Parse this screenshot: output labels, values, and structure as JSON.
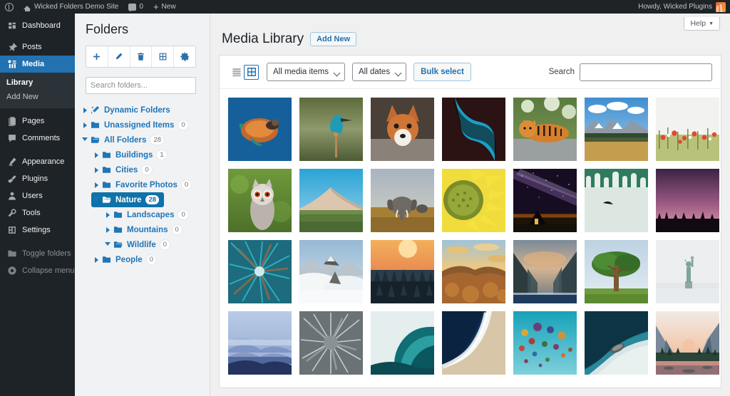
{
  "adminbar": {
    "wp_logo": "wordpress-logo",
    "site_name": "Wicked Folders Demo Site",
    "comments_count": "0",
    "new_label": "New",
    "howdy": "Howdy, Wicked Plugins"
  },
  "adminmenu": {
    "items": [
      {
        "label": "Dashboard",
        "icon": "dashboard-icon",
        "current": false
      },
      {
        "label": "Posts",
        "icon": "pin-icon",
        "current": false
      },
      {
        "label": "Media",
        "icon": "media-icon",
        "current": true
      },
      {
        "label": "Pages",
        "icon": "pages-icon",
        "current": false
      },
      {
        "label": "Comments",
        "icon": "comments-icon",
        "current": false
      },
      {
        "label": "Appearance",
        "icon": "appearance-icon",
        "current": false
      },
      {
        "label": "Plugins",
        "icon": "plugins-icon",
        "current": false
      },
      {
        "label": "Users",
        "icon": "users-icon",
        "current": false
      },
      {
        "label": "Tools",
        "icon": "tools-icon",
        "current": false
      },
      {
        "label": "Settings",
        "icon": "settings-icon",
        "current": false
      },
      {
        "label": "Toggle folders",
        "icon": "folder-icon",
        "current": false
      },
      {
        "label": "Collapse menu",
        "icon": "collapse-icon",
        "current": false
      }
    ],
    "media_submenu": [
      {
        "label": "Library",
        "current": true
      },
      {
        "label": "Add New",
        "current": false
      }
    ]
  },
  "folders": {
    "title": "Folders",
    "toolbar": [
      {
        "name": "add-folder-button",
        "icon": "plus-icon"
      },
      {
        "name": "edit-folder-button",
        "icon": "pencil-icon"
      },
      {
        "name": "delete-folder-button",
        "icon": "trash-icon"
      },
      {
        "name": "organize-button",
        "icon": "grid-plus-icon"
      },
      {
        "name": "folder-settings-button",
        "icon": "gear-icon"
      }
    ],
    "search_placeholder": "Search folders...",
    "tree": [
      {
        "label": "Dynamic Folders",
        "count": "",
        "depth": 0,
        "expanded": false,
        "selected": false,
        "icon": "magic-wand-icon"
      },
      {
        "label": "Unassigned Items",
        "count": "0",
        "depth": 0,
        "expanded": false,
        "selected": false,
        "icon": "folder-icon"
      },
      {
        "label": "All Folders",
        "count": "28",
        "depth": 0,
        "expanded": true,
        "selected": false,
        "icon": "folder-open-icon"
      },
      {
        "label": "Buildings",
        "count": "1",
        "depth": 1,
        "expanded": false,
        "selected": false,
        "icon": "folder-icon"
      },
      {
        "label": "Cities",
        "count": "0",
        "depth": 1,
        "expanded": false,
        "selected": false,
        "icon": "folder-icon"
      },
      {
        "label": "Favorite Photos",
        "count": "0",
        "depth": 1,
        "expanded": false,
        "selected": false,
        "icon": "folder-icon"
      },
      {
        "label": "Nature",
        "count": "28",
        "depth": 1,
        "expanded": true,
        "selected": true,
        "icon": "folder-open-icon"
      },
      {
        "label": "Landscapes",
        "count": "0",
        "depth": 2,
        "expanded": false,
        "selected": false,
        "icon": "folder-icon"
      },
      {
        "label": "Mountains",
        "count": "0",
        "depth": 2,
        "expanded": false,
        "selected": false,
        "icon": "folder-icon"
      },
      {
        "label": "Wildlife",
        "count": "0",
        "depth": 2,
        "expanded": true,
        "selected": false,
        "icon": "folder-open-icon"
      },
      {
        "label": "People",
        "count": "0",
        "depth": 1,
        "expanded": false,
        "selected": false,
        "icon": "folder-icon"
      }
    ]
  },
  "main": {
    "help_tab": "Help",
    "page_title": "Media Library",
    "add_new": "Add New",
    "toolbar": {
      "list_view": "list-view-icon",
      "grid_view": "grid-view-icon",
      "media_filter": "All media items",
      "date_filter": "All dates",
      "bulk_select": "Bulk select",
      "search_label": "Search",
      "search_value": ""
    },
    "media_items": [
      {
        "alt": "sea-turtle",
        "theme": "turtle"
      },
      {
        "alt": "kingfisher-bird",
        "theme": "kingfisher"
      },
      {
        "alt": "red-fox",
        "theme": "fox"
      },
      {
        "alt": "blue-canyon-river",
        "theme": "canyon"
      },
      {
        "alt": "tiger-resting",
        "theme": "tiger"
      },
      {
        "alt": "mountain-meadow",
        "theme": "mountainmeadow"
      },
      {
        "alt": "poppy-field",
        "theme": "poppy"
      },
      {
        "alt": "white-faced-owl",
        "theme": "owl"
      },
      {
        "alt": "sand-dune",
        "theme": "dune"
      },
      {
        "alt": "elephant-savanna",
        "theme": "elephant"
      },
      {
        "alt": "sunflower-closeup",
        "theme": "sunflower"
      },
      {
        "alt": "milky-way-church",
        "theme": "milkyway"
      },
      {
        "alt": "bird-over-waterfall",
        "theme": "waterfall"
      },
      {
        "alt": "purple-dusk-treeline",
        "theme": "dusk"
      },
      {
        "alt": "forest-canopy-upward",
        "theme": "canopy"
      },
      {
        "alt": "snowy-peak-above-clouds",
        "theme": "snowpeak"
      },
      {
        "alt": "sunrise-over-pine-forest",
        "theme": "sunrisepines"
      },
      {
        "alt": "golden-mountain-clouds",
        "theme": "goldenmtn"
      },
      {
        "alt": "fjord-lake-valley",
        "theme": "fjord"
      },
      {
        "alt": "lone-tree-meadow",
        "theme": "lonetree"
      },
      {
        "alt": "statue-of-liberty-fog",
        "theme": "liberty"
      },
      {
        "alt": "blue-layered-mountains",
        "theme": "bluemtn"
      },
      {
        "alt": "fish-school-aerial",
        "theme": "fishschool"
      },
      {
        "alt": "ocean-wave-barrel",
        "theme": "wave"
      },
      {
        "alt": "aerial-shoreline-surf",
        "theme": "shoreline"
      },
      {
        "alt": "hot-air-balloons",
        "theme": "balloons"
      },
      {
        "alt": "boat-turquoise-shore",
        "theme": "boat"
      },
      {
        "alt": "yosemite-valley-sunset",
        "theme": "yosemite"
      }
    ]
  },
  "colors": {
    "accent_blue": "#2271b1",
    "folder_blue": "#1f76b8",
    "selected_folder": "#0f72a8",
    "admin_dark": "#1d2327",
    "admin_submenu": "#2c3338"
  }
}
